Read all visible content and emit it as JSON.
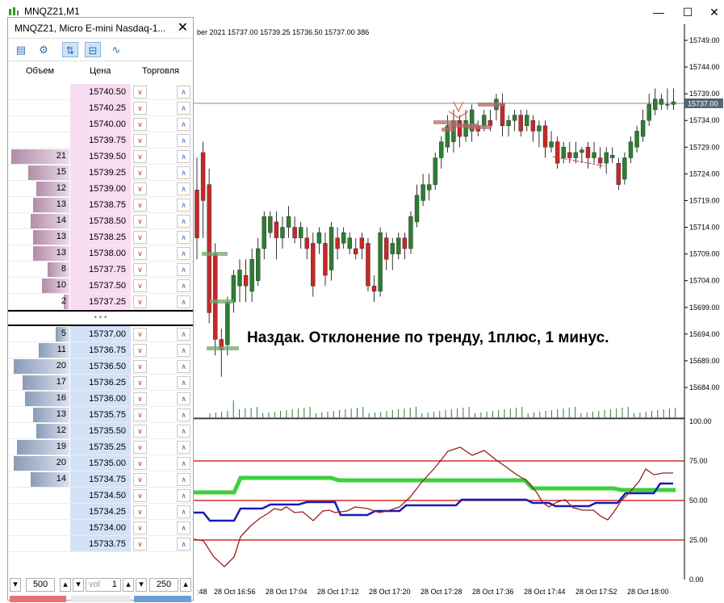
{
  "window": {
    "title": "MNQZ21,M1",
    "minimize": "—",
    "maximize": "☐",
    "close": "✕"
  },
  "dom": {
    "title": "MNQZ21, Micro E-mini Nasdaq-1...",
    "close": "✕",
    "col_volume": "Объем",
    "col_price": "Цена",
    "col_trade": "Торговля",
    "separator": "• • •",
    "asks": [
      {
        "price": "15740.50",
        "vol": ""
      },
      {
        "price": "15740.25",
        "vol": ""
      },
      {
        "price": "15740.00",
        "vol": ""
      },
      {
        "price": "15739.75",
        "vol": ""
      },
      {
        "price": "15739.50",
        "vol": "21"
      },
      {
        "price": "15739.25",
        "vol": "15"
      },
      {
        "price": "15739.00",
        "vol": "12"
      },
      {
        "price": "15738.75",
        "vol": "13"
      },
      {
        "price": "15738.50",
        "vol": "14"
      },
      {
        "price": "15738.25",
        "vol": "13"
      },
      {
        "price": "15738.00",
        "vol": "13"
      },
      {
        "price": "15737.75",
        "vol": "8"
      },
      {
        "price": "15737.50",
        "vol": "10"
      },
      {
        "price": "15737.25",
        "vol": "2"
      }
    ],
    "bids": [
      {
        "price": "15737.00",
        "vol": "5"
      },
      {
        "price": "15736.75",
        "vol": "11"
      },
      {
        "price": "15736.50",
        "vol": "20"
      },
      {
        "price": "15736.25",
        "vol": "17"
      },
      {
        "price": "15736.00",
        "vol": "16"
      },
      {
        "price": "15735.75",
        "vol": "13"
      },
      {
        "price": "15735.50",
        "vol": "12"
      },
      {
        "price": "15735.25",
        "vol": "19"
      },
      {
        "price": "15735.00",
        "vol": "20"
      },
      {
        "price": "15734.75",
        "vol": "14"
      },
      {
        "price": "15734.50",
        "vol": ""
      },
      {
        "price": "15734.25",
        "vol": ""
      },
      {
        "price": "15734.00",
        "vol": ""
      },
      {
        "price": "15733.75",
        "vol": ""
      }
    ],
    "footer": {
      "qty_left": "500",
      "vol_label": "vol",
      "vol_value": "1",
      "qty_right": "250"
    }
  },
  "chart": {
    "info_line": "ber 2021  15737.00  15739.25  15736.50  15737.00  386",
    "annotation": "Наздак. Отклонение по тренду, 1плюс, 1 минус.",
    "current_price": "15737.00",
    "price_ticks": [
      "15749.00",
      "15744.00",
      "15739.00",
      "15734.00",
      "15729.00",
      "15724.00",
      "15719.00",
      "15714.00",
      "15709.00",
      "15704.00",
      "15699.00",
      "15694.00",
      "15689.00",
      "15684.00"
    ],
    "osc_ticks": [
      "100.00",
      "75.00",
      "50.00",
      "25.00",
      "0.00"
    ],
    "time_ticks": [
      ":48",
      "28 Oct 16:56",
      "28 Oct 17:04",
      "28 Oct 17:12",
      "28 Oct 17:20",
      "28 Oct 17:28",
      "28 Oct 17:36",
      "28 Oct 17:44",
      "28 Oct 17:52",
      "28 Oct 18:00"
    ],
    "colors": {
      "bull": "#2e7d32",
      "bear": "#c62828",
      "green_line": "#3ecf3e",
      "blue_line": "#1a1ab8",
      "brown_line": "#9b1c1c",
      "level_line": "#cc0000"
    }
  }
}
